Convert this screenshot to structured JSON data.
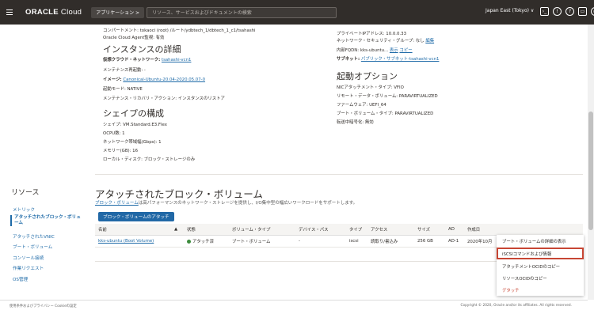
{
  "topbar": {
    "brand": "ORACLE",
    "brand_suffix": "Cloud",
    "apps_label": "アプリケーション >",
    "search_placeholder": "リソース、サービスおよびドキュメントの検索",
    "region": "Japan East (Tokyo) ∨"
  },
  "top_kv": {
    "compartment": "コンパートメント: tokaoci (root) /ルート/ydbtech_1/dbtech_1_c1/tsahashi",
    "agent": "Oracle Cloud Agent監視: 有効",
    "private_ip": "プライベートIPアドレス: 10.0.0.33",
    "nsg_label": "ネットワーク・セキュリティ・グループ: なし",
    "nsg_link": "編集",
    "fqdn_label": "内部FQDN: kks-ubuntu...",
    "fqdn_show": "表示",
    "fqdn_copy": "コピー",
    "subnet_label": "サブネット:",
    "subnet_link": "パブリック・サブネット-tsahashi-vcn1"
  },
  "instance_details": {
    "title": "インスタンスの詳細",
    "vcn_label": "仮想クラウド・ネットワーク:",
    "vcn_link": "tsahashi-vcn1",
    "maintenance": "メンテナンス再起動: -",
    "image_label": "イメージ:",
    "image_link": "Canonical-Ubuntu-20.04-2020.05.07-0",
    "boot_mode": "起動モード: NATIVE",
    "recovery": "メンテナンス・リカバリ・アクション: インスタンスのリストア"
  },
  "launch_options": {
    "title": "起動オプション",
    "nic": "NICアタッチメント・タイプ: VFIO",
    "remote_data": "リモート・データ・ボリューム: PARAVIRTUALIZED",
    "firmware": "ファームウェア: UEFI_64",
    "boot_vol": "ブート・ボリューム・タイプ: PARAVIRTUALIZED",
    "transit": "転送中暗号化: 無効"
  },
  "shape_config": {
    "title": "シェイプの構成",
    "shape": "シェイプ: VM.Standard.E3.Flex",
    "ocpu": "OCPU数: 1",
    "bandwidth": "ネットワーク帯域幅(Gbps): 1",
    "memory": "メモリー(GB): 16",
    "local_disk": "ローカル・ディスク: ブロック・ストレージのみ"
  },
  "sidebar": {
    "title": "リソース",
    "items": [
      "メトリック",
      "アタッチされたブロック・ボリューム",
      "アタッチされたVNIC",
      "ブート・ボリューム",
      "コンソール接続",
      "作業リクエスト",
      "OS管理"
    ]
  },
  "block_volumes": {
    "title": "アタッチされたブロック・ボリューム",
    "desc_link": "ブロック・ボリューム",
    "desc_rest": "は高パフォーマンスのネットワーク・ストレージを提供し、I/O集中型の幅広いワークロードをサポートします。",
    "attach_button": "ブロック・ボリュームのアタッチ",
    "columns": [
      "名前",
      "▲",
      "状態",
      "ボリューム・タイプ",
      "デバイス・パス",
      "タイプ",
      "アクセス",
      "サイズ",
      "AD",
      "作成日"
    ],
    "row": {
      "name": "kks-ubuntu (Boot Volume)",
      "state": "アタッチ済",
      "volume_type": "ブート・ボリューム",
      "device_path": "-",
      "type": "iscsi",
      "access": "読取り/書込み",
      "size": "256 GB",
      "ad": "AD-1",
      "created": "2020年10月"
    }
  },
  "context_menu": {
    "items": [
      "ブート・ボリュームの詳細の表示",
      "iSCSIコマンドおよび情報",
      "アタッチメントOCIDのコピー",
      "リソースOCIDのコピー",
      "デタッチ"
    ]
  },
  "footer": {
    "left": "使用条件およびプライバシー   Cookieの設定",
    "right": "Copyright © 2020, Oracle and/or its affiliates. All rights reserved."
  }
}
